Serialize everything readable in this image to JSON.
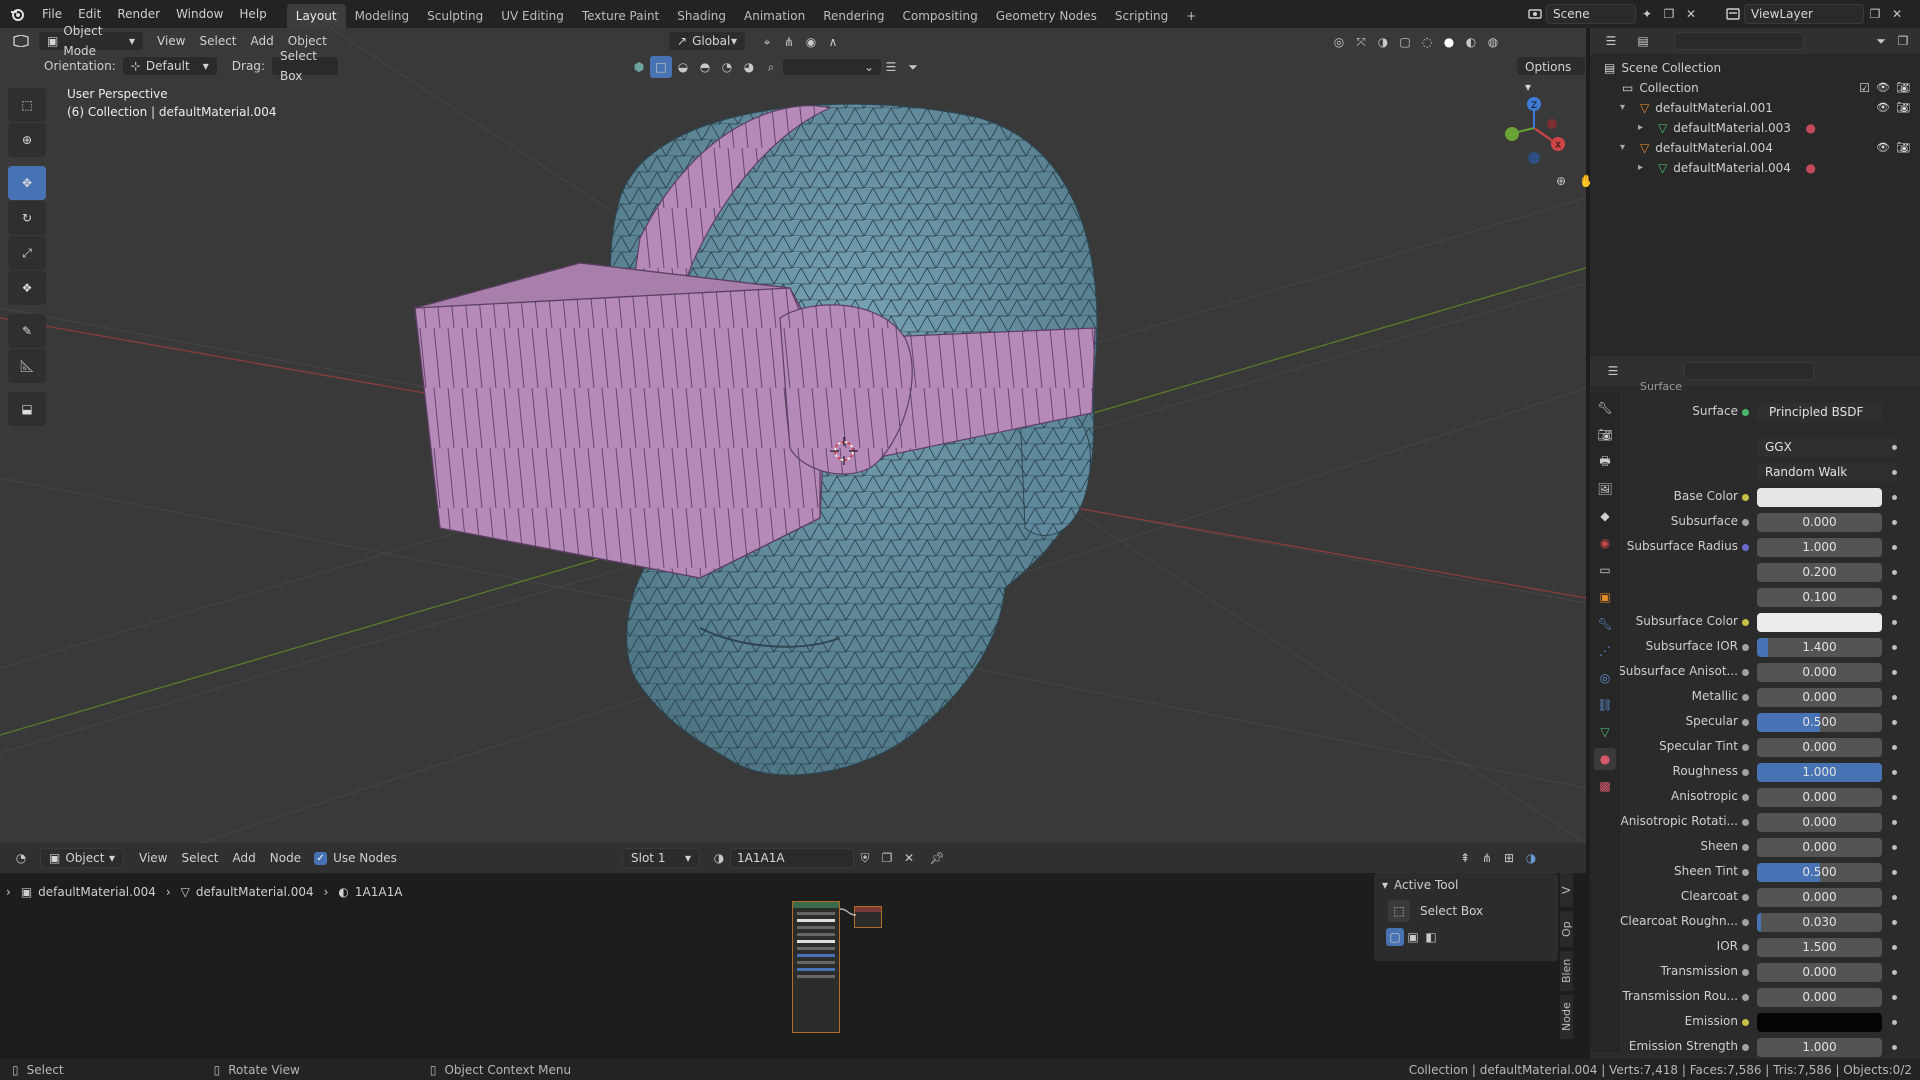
{
  "topbar": {
    "menus": [
      "File",
      "Edit",
      "Render",
      "Window",
      "Help"
    ],
    "workspaces": [
      "Layout",
      "Modeling",
      "Sculpting",
      "UV Editing",
      "Texture Paint",
      "Shading",
      "Animation",
      "Rendering",
      "Compositing",
      "Geometry Nodes",
      "Scripting"
    ],
    "active_workspace": "Layout",
    "scene": "Scene",
    "view_layer": "ViewLayer"
  },
  "viewport": {
    "mode": "Object Mode",
    "menus": [
      "View",
      "Select",
      "Add",
      "Object"
    ],
    "orientation_label": "Orientation:",
    "orientation_value": "Default",
    "drag_label": "Drag:",
    "drag_value": "Select Box",
    "transform_orientation": "Global",
    "options_label": "Options",
    "overlay_title": "User Perspective",
    "overlay_subtitle": "(6) Collection | defaultMaterial.004"
  },
  "outliner": {
    "rows": [
      {
        "label": "Scene Collection",
        "indent": 0,
        "icon": "scene-collection-icon"
      },
      {
        "label": "Collection",
        "indent": 1,
        "icon": "collection-icon"
      },
      {
        "label": "defaultMaterial.001",
        "indent": 2,
        "icon": "mesh-object-icon"
      },
      {
        "label": "defaultMaterial.003",
        "indent": 3,
        "icon": "mesh-data-icon"
      },
      {
        "label": "defaultMaterial.004",
        "indent": 2,
        "icon": "mesh-object-icon"
      },
      {
        "label": "defaultMaterial.004",
        "indent": 3,
        "icon": "mesh-data-icon"
      }
    ]
  },
  "properties": {
    "panel_title": "Surface",
    "surface_label": "Surface",
    "surface_value": "Principled BSDF",
    "distribution": "GGX",
    "subsurface_method": "Random Walk",
    "rows": [
      {
        "label": "Base Color",
        "value": "",
        "swatch": "#e6e6e6",
        "dot": "#c9c04a"
      },
      {
        "label": "Subsurface",
        "value": "0.000",
        "fill": 0,
        "dot": "#a1a1a1"
      },
      {
        "label": "Subsurface Radius",
        "value": "1.000",
        "fill": 0,
        "dot": "#6b6bc9"
      },
      {
        "label": "",
        "value": "0.200",
        "fill": 0,
        "dot": ""
      },
      {
        "label": "",
        "value": "0.100",
        "fill": 0,
        "dot": ""
      },
      {
        "label": "Subsurface Color",
        "value": "",
        "swatch": "#ececec",
        "dot": "#c9c04a"
      },
      {
        "label": "Subsurface IOR",
        "value": "1.400",
        "fill": 0.09,
        "dot": "#a1a1a1"
      },
      {
        "label": "Subsurface Anisot...",
        "value": "0.000",
        "fill": 0,
        "dot": "#a1a1a1"
      },
      {
        "label": "Metallic",
        "value": "0.000",
        "fill": 0,
        "dot": "#a1a1a1"
      },
      {
        "label": "Specular",
        "value": "0.500",
        "fill": 0.5,
        "dot": "#a1a1a1"
      },
      {
        "label": "Specular Tint",
        "value": "0.000",
        "fill": 0,
        "dot": "#a1a1a1"
      },
      {
        "label": "Roughness",
        "value": "1.000",
        "fill": 1.0,
        "dot": "#a1a1a1"
      },
      {
        "label": "Anisotropic",
        "value": "0.000",
        "fill": 0,
        "dot": "#a1a1a1"
      },
      {
        "label": "Anisotropic Rotati...",
        "value": "0.000",
        "fill": 0,
        "dot": "#a1a1a1"
      },
      {
        "label": "Sheen",
        "value": "0.000",
        "fill": 0,
        "dot": "#a1a1a1"
      },
      {
        "label": "Sheen Tint",
        "value": "0.500",
        "fill": 0.5,
        "dot": "#a1a1a1"
      },
      {
        "label": "Clearcoat",
        "value": "0.000",
        "fill": 0,
        "dot": "#a1a1a1"
      },
      {
        "label": "Clearcoat Roughn...",
        "value": "0.030",
        "fill": 0.03,
        "dot": "#a1a1a1"
      },
      {
        "label": "IOR",
        "value": "1.500",
        "fill": 0,
        "dot": "#a1a1a1"
      },
      {
        "label": "Transmission",
        "value": "0.000",
        "fill": 0,
        "dot": "#a1a1a1"
      },
      {
        "label": "Transmission Rou...",
        "value": "0.000",
        "fill": 0,
        "dot": "#a1a1a1"
      },
      {
        "label": "Emission",
        "value": "",
        "swatch": "#050505",
        "dot": "#c9c04a"
      },
      {
        "label": "Emission Strength",
        "value": "1.000",
        "fill": 0,
        "dot": "#a1a1a1"
      }
    ]
  },
  "node_editor": {
    "type": "Object",
    "menus": [
      "View",
      "Select",
      "Add",
      "Node"
    ],
    "use_nodes": "Use Nodes",
    "slot": "Slot 1",
    "material": "1A1A1A",
    "breadcrumb": [
      "defaultMaterial.004",
      "defaultMaterial.004",
      "1A1A1A"
    ],
    "active_tool_title": "Active Tool",
    "active_tool_name": "Select Box",
    "side_tabs": [
      "Node",
      "Blen",
      "Op",
      "V"
    ]
  },
  "status": {
    "hint1": "Select",
    "hint2": "Rotate View",
    "hint3": "Object Context Menu",
    "stats": "Collection | defaultMaterial.004 | Verts:7,418 | Faces:7,586 | Tris:7,586 | Objects:0/2"
  },
  "colors": {
    "accent": "#4772b3",
    "head": "#5f8a9e",
    "goggles": "#b58ab8"
  }
}
